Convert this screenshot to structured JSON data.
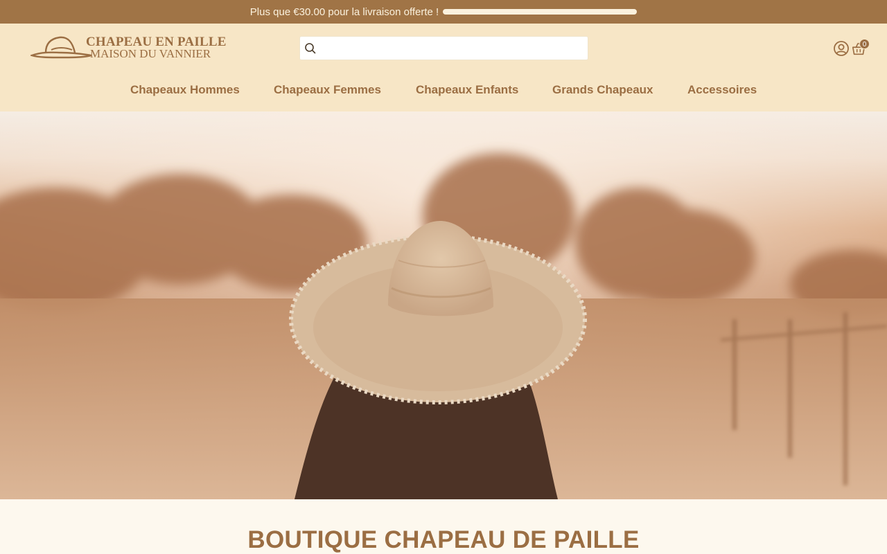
{
  "announcement": {
    "text": "Plus que €30.00 pour la livraison offerte !",
    "progress_fraction": 1.0
  },
  "header": {
    "logo_line1": "CHAPEAU EN PAILLE",
    "logo_line2": "MAISON DU VANNIER",
    "search": {
      "placeholder": "",
      "value": ""
    },
    "cart_count": "0",
    "icons": {
      "search": "search-icon",
      "account": "account-icon",
      "cart": "shopping-basket-icon"
    }
  },
  "nav": {
    "items": [
      {
        "label": "Chapeaux Hommes"
      },
      {
        "label": "Chapeaux Femmes"
      },
      {
        "label": "Chapeaux Enfants"
      },
      {
        "label": "Grands Chapeaux"
      },
      {
        "label": "Accessoires"
      }
    ]
  },
  "main": {
    "title": "BOUTIQUE CHAPEAU DE PAILLE"
  },
  "colors": {
    "brand": "#9b6e43",
    "announcement_bg": "#a07446",
    "header_bg": "#f7e6c6",
    "page_bg": "#fdf8ee"
  }
}
